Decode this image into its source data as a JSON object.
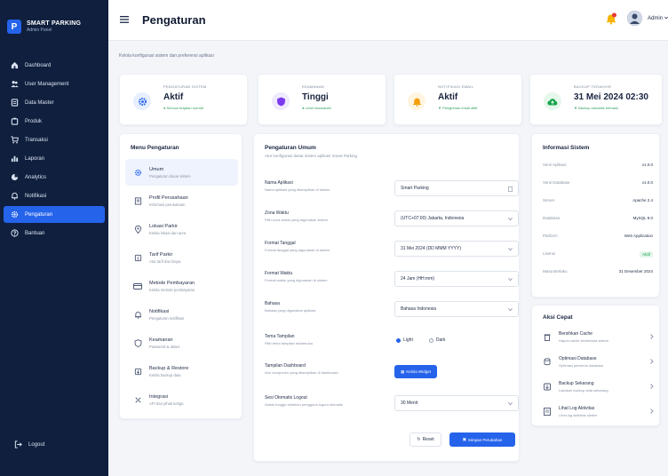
{
  "brand": {
    "name": "SMART PARKING",
    "sub": "Admin Panel",
    "logo": "P"
  },
  "nav": [
    {
      "label": "Dashboard",
      "icon": "home-icon"
    },
    {
      "label": "User Management",
      "icon": "users-icon"
    },
    {
      "label": "Data Master",
      "icon": "database-icon"
    },
    {
      "label": "Produk",
      "icon": "box-icon"
    },
    {
      "label": "Transaksi",
      "icon": "cart-icon"
    },
    {
      "label": "Laporan",
      "icon": "bar-chart-icon"
    },
    {
      "label": "Analytics",
      "icon": "pie-icon"
    },
    {
      "label": "Notifikasi",
      "icon": "bell-icon"
    },
    {
      "label": "Pengaturan",
      "icon": "gear-icon",
      "active": true
    },
    {
      "label": "Bantuan",
      "icon": "help-icon"
    }
  ],
  "logout": "Logout",
  "header": {
    "title": "Pengaturan",
    "user": "Admin"
  },
  "subtitle": "Kelola konfigurasi sistem dan preferensi aplikasi",
  "stats": [
    {
      "label": "PENGATURAN SISTEM",
      "value": "Aktif",
      "sub": "● Semua berjalan normal",
      "color": "#2563eb",
      "bg": "#e7efff"
    },
    {
      "label": "KEAMANAN",
      "value": "Tinggi",
      "sub": "● Level keamanan",
      "color": "#7c3aed",
      "bg": "#f0eafe"
    },
    {
      "label": "NOTIFIKASI EMAIL",
      "value": "Aktif",
      "sub": "▼ Pengiriman email aktif",
      "color": "#f59e0b",
      "bg": "#fff5e0"
    },
    {
      "label": "BACKUP TERAKHIR",
      "value": "31 Mei 2024 02:30",
      "sub": "▼ Backup otomatis berhasil",
      "color": "#16a34a",
      "bg": "#e6f7ec"
    }
  ],
  "menu": {
    "title": "Menu Pengaturan",
    "items": [
      {
        "name": "Umum",
        "desc": "Pengaturan dasar sistem",
        "icon": "gear-icon",
        "active": true
      },
      {
        "name": "Profil Perusahaan",
        "desc": "Informasi perusahaan",
        "icon": "building-icon"
      },
      {
        "name": "Lokasi Parkir",
        "desc": "Kelola lokasi dan area",
        "icon": "location-icon"
      },
      {
        "name": "Tarif Parkir",
        "desc": "Atur tarif dan biaya",
        "icon": "tag-icon"
      },
      {
        "name": "Metode Pembayaran",
        "desc": "Kelola metode pembayaran",
        "icon": "card-icon"
      },
      {
        "name": "Notifikasi",
        "desc": "Pengaturan notifikasi",
        "icon": "bell-icon"
      },
      {
        "name": "Keamanan",
        "desc": "Password & akses",
        "icon": "shield-icon"
      },
      {
        "name": "Backup & Restore",
        "desc": "Kelola backup data",
        "icon": "backup-icon"
      },
      {
        "name": "Integrasi",
        "desc": "API dan pihak ketiga",
        "icon": "integration-icon"
      }
    ]
  },
  "general": {
    "title": "Pengaturan Umum",
    "desc": "Atur konfigurasi dasar sistem aplikasi Smart Parking",
    "fields": [
      {
        "label": "Nama Aplikasi",
        "desc": "Nama aplikasi yang ditampilkan di sistem",
        "value": "Smart Parking",
        "type": "text"
      },
      {
        "label": "Zona Waktu",
        "desc": "Pilih zona waktu yang digunakan sistem",
        "value": "(UTC+07:00) Jakarta, Indonesia",
        "type": "select"
      },
      {
        "label": "Format Tanggal",
        "desc": "Format tanggal yang digunakan di sistem",
        "value": "31 Mei 2024 (DD MMM YYYY)",
        "type": "select"
      },
      {
        "label": "Format Waktu",
        "desc": "Format waktu yang digunakan di sistem",
        "value": "24 Jam (HH:mm)",
        "type": "select"
      },
      {
        "label": "Bahasa",
        "desc": "Bahasa yang digunakan aplikasi",
        "value": "Bahasa Indonesia",
        "type": "select"
      }
    ],
    "theme": {
      "label": "Tema Tampilan",
      "desc": "Pilih tema tampilan antarmuka",
      "light": "Light",
      "dark": "Dark"
    },
    "dashboard": {
      "label": "Tampilan Dashboard",
      "desc": "Atur komponen yang ditampilkan di dashboard",
      "button": "Kelola Widget"
    },
    "logout": {
      "label": "Sesi Otomatis Logout",
      "desc": "Waktu tunggu sebelum pengguna logout otomatis",
      "value": "30 Menit"
    },
    "reset": "Reset",
    "save": "Simpan Perubahan"
  },
  "info": {
    "title": "Informasi Sistem",
    "rows": [
      {
        "k": "Versi Aplikasi",
        "v": "v1.0.0"
      },
      {
        "k": "Versi Database",
        "v": "v1.0.0"
      },
      {
        "k": "Server",
        "v": "Apache 2.4"
      },
      {
        "k": "Database",
        "v": "MySQL 8.0"
      },
      {
        "k": "Platform",
        "v": "Web Application"
      },
      {
        "k": "Lisensi",
        "v": "Aktif"
      },
      {
        "k": "Masa Berlaku",
        "v": "31 Desember 2024"
      }
    ]
  },
  "quick": {
    "title": "Aksi Cepat",
    "items": [
      {
        "name": "Bersihkan Cache",
        "desc": "Hapus cache sementara sistem",
        "icon": "trash-icon"
      },
      {
        "name": "Optimasi Database",
        "desc": "Optimasi performa database",
        "icon": "database-icon"
      },
      {
        "name": "Backup Sekarang",
        "desc": "Lakukan backup data sekarang",
        "icon": "backup-icon"
      },
      {
        "name": "Lihat Log Aktivitas",
        "desc": "Lihat log aktivitas sistem",
        "icon": "log-icon"
      }
    ]
  }
}
